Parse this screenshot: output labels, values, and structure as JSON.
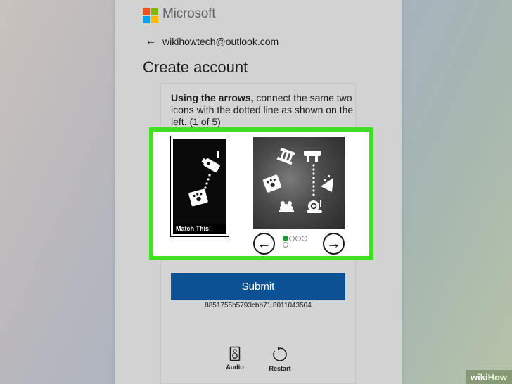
{
  "brand": {
    "name": "Microsoft",
    "logo_colors": [
      "#f25022",
      "#7fba00",
      "#00a4ef",
      "#ffb900"
    ]
  },
  "account": {
    "email": "wikihowtech@outlook.com"
  },
  "page": {
    "title": "Create account"
  },
  "puzzle": {
    "instruction_bold": "Using the arrows,",
    "instruction_rest": " connect the same two icons with the dotted line as shown on the left. (1 of 5)",
    "reference_label": "Match This!",
    "prev_label": "←",
    "next_label": "→",
    "page_dots": 5,
    "active_dot": 1,
    "highlight_color": "#3ee020"
  },
  "submit": {
    "label": "Submit",
    "color": "#0b5194"
  },
  "challenge": {
    "id": "8851755b5793cbb71.8011043504"
  },
  "tools": {
    "audio_label": "Audio",
    "restart_label": "Restart"
  },
  "watermark": {
    "wiki": "wiki",
    "how": "How"
  }
}
